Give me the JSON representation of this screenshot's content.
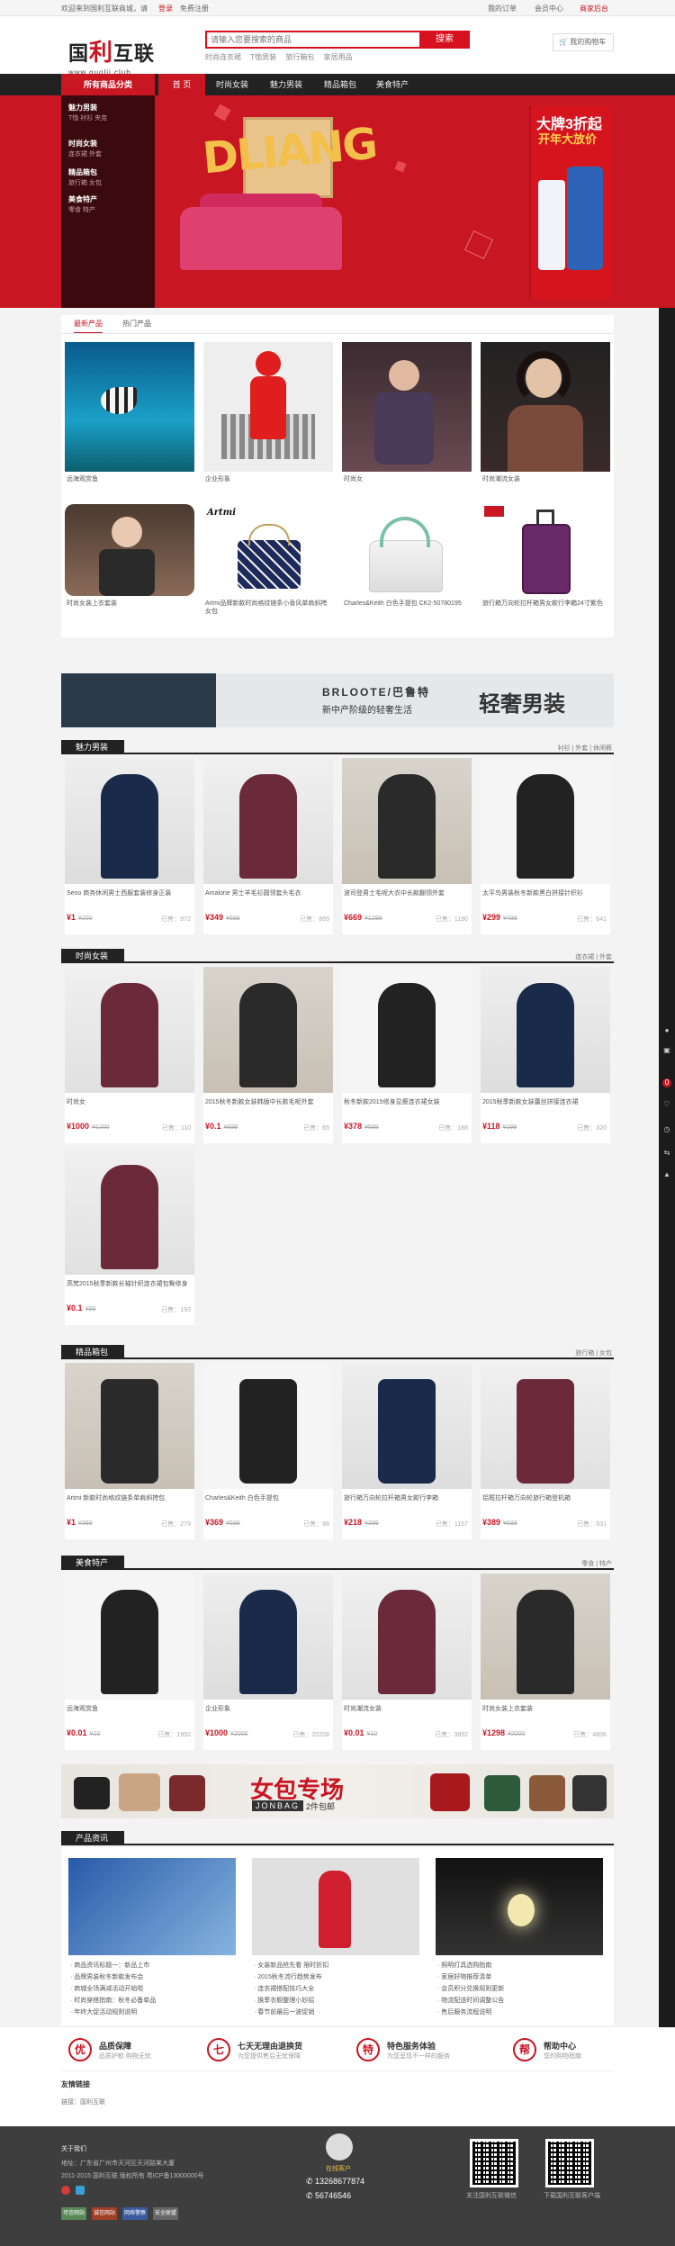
{
  "topbar": {
    "welcome": "欢迎来到国利互联商城，请",
    "login": "登录",
    "register": "免费注册",
    "my_orders": "我的订单",
    "user_center": "会员中心",
    "seller": "商家后台"
  },
  "header": {
    "logo_cn_a": "国",
    "logo_cn_b": "利",
    "logo_cn_c": "互联",
    "logo_url": "www.guolii.club",
    "search_placeholder": "请输入您要搜索的商品",
    "search_button": "搜索",
    "hot_words": [
      "时尚连衣裙",
      "T恤男装",
      "旅行箱包",
      "家居用品"
    ],
    "cart_label": "我的购物车"
  },
  "nav": {
    "category_label": "所有商品分类",
    "items": [
      "首 页",
      "时尚女装",
      "魅力男装",
      "精品箱包",
      "美食特产"
    ],
    "active_index": 0
  },
  "categories": [
    {
      "name": "魅力男装",
      "subs": "T恤 衬衫 夹克"
    },
    {
      "name": "时尚女装",
      "subs": "连衣裙 外套"
    },
    {
      "name": "精品箱包",
      "subs": "旅行箱 女包"
    },
    {
      "name": "美食特产",
      "subs": "零食 特产"
    }
  ],
  "banner": {
    "headline": "DLIANG",
    "promo_line1": "大牌3折起",
    "promo_line2": "开年大放价",
    "accent": "#c81623"
  },
  "tabs": [
    "最新产品",
    "热门产品"
  ],
  "tab_products": [
    {
      "name": "远海观赏鱼"
    },
    {
      "name": "企业形象"
    },
    {
      "name": "时尚女"
    },
    {
      "name": "时尚潮流女装"
    },
    {
      "name": "时尚女装上衣套装"
    },
    {
      "name": "Artmi品牌新款时尚格纹链条小香风单肩斜挎女包"
    },
    {
      "name": "Charles&Keith 白色手提包 CK2-50780195"
    },
    {
      "name": "旅行箱万向轮拉杆箱男女款行李箱24寸紫色"
    }
  ],
  "ad1": {
    "brand": "BRLOOTE/巴鲁特",
    "slogan": "新中产阶级的轻奢生活",
    "title": "轻奢男装"
  },
  "sections": [
    {
      "title": "魅力男装",
      "more": "衬衫 | 外套 | 休闲裤",
      "products": [
        {
          "name": "Seno 商务休闲男士西服套装修身正装",
          "price": "¥1",
          "old": "¥200",
          "sold": "已售：972"
        },
        {
          "name": "Amalone 男士羊毛衫圆领套头毛衣",
          "price": "¥349",
          "old": "¥599",
          "sold": "已售：889"
        },
        {
          "name": "波司登男士毛呢大衣中长款翻领外套",
          "price": "¥669",
          "old": "¥1299",
          "sold": "已售：1190"
        },
        {
          "name": "太平鸟男装秋冬新款黑白拼接针织衫",
          "price": "¥299",
          "old": "¥499",
          "sold": "已售：641"
        }
      ]
    },
    {
      "title": "时尚女装",
      "more": "连衣裙 | 外套",
      "products": [
        {
          "name": "时尚女",
          "price": "¥1000",
          "old": "¥1200",
          "sold": "已售：110"
        },
        {
          "name": "2015秋冬新款女装韩版中长款毛呢外套",
          "price": "¥0.1",
          "old": "¥899",
          "sold": "已售：65"
        },
        {
          "name": "秋冬新款2015修身显瘦连衣裙女装",
          "price": "¥378",
          "old": "¥599",
          "sold": "已售：188"
        },
        {
          "name": "2015秋季新款女装蕾丝拼接连衣裙",
          "price": "¥118",
          "old": "¥299",
          "sold": "已售：320"
        },
        {
          "name": "高梵2015秋季新款长袖针织连衣裙包臀修身",
          "price": "¥0.1",
          "old": "¥99",
          "sold": "已售：193"
        }
      ]
    },
    {
      "title": "精品箱包",
      "more": "旅行箱 | 女包",
      "products": [
        {
          "name": "Artmi 新款时尚格纹链条单肩斜挎包",
          "price": "¥1",
          "old": "¥369",
          "sold": "已售：279"
        },
        {
          "name": "Charles&Keith 白色手提包",
          "price": "¥369",
          "old": "¥599",
          "sold": "已售：88"
        },
        {
          "name": "旅行箱万向轮拉杆箱男女款行李箱",
          "price": "¥218",
          "old": "¥399",
          "sold": "已售：1157"
        },
        {
          "name": "铝框拉杆箱万向轮旅行箱登机箱",
          "price": "¥389",
          "old": "¥699",
          "sold": "已售：531"
        }
      ]
    },
    {
      "title": "美食特产",
      "more": "零食 | 特产",
      "products": [
        {
          "name": "远海观赏鱼",
          "price": "¥0.01",
          "old": "¥10",
          "sold": "已售：1992"
        },
        {
          "name": "企业形象",
          "price": "¥1000",
          "old": "¥2000",
          "sold": "已售：20208"
        },
        {
          "name": "时尚潮流女装",
          "price": "¥0.01",
          "old": "¥10",
          "sold": "已售：3892"
        },
        {
          "name": "时尚女装上衣套装",
          "price": "¥1298",
          "old": "¥2000",
          "sold": "已售：4806"
        }
      ]
    }
  ],
  "ad2": {
    "title": "女包专场",
    "brand": "JONBAG",
    "promo": "2件包邮"
  },
  "news": {
    "title": "产品资讯",
    "columns": [
      [
        "商品资讯标题一：新品上市",
        "品牌男装秋冬新款发布会",
        "商城全场满减活动开始啦",
        "时尚穿搭指南：秋冬必备单品",
        "年终大促活动规则说明"
      ],
      [
        "女装新品抢先看 限时折扣",
        "2015秋冬流行趋势发布",
        "连衣裙搭配技巧大全",
        "换季衣橱整理小妙招",
        "春节前最后一波促销"
      ],
      [
        "照明灯具选购指南",
        "家居好物推荐清单",
        "会员积分兑换规则更新",
        "物流配送时间调整公告",
        "售后服务流程说明"
      ]
    ]
  },
  "services": [
    {
      "icon": "优",
      "title": "品质保障",
      "desc": "品质护航 购物无忧"
    },
    {
      "icon": "七",
      "title": "七天无理由退换货",
      "desc": "为您提供售后无忧保障"
    },
    {
      "icon": "特",
      "title": "特色服务体验",
      "desc": "为您呈现不一样的服务"
    },
    {
      "icon": "帮",
      "title": "帮助中心",
      "desc": "您的购物指南"
    }
  ],
  "friend_links": {
    "title": "友情链接",
    "items": [
      "国利互联"
    ]
  },
  "footer": {
    "about": "关于我们",
    "address": "地址：广东省广州市天河区天河路某大厦",
    "copyright": "2011-2015 国利互联 版权所有 粤ICP备13000000号",
    "phone1": "13268677874",
    "phone2": "56746546",
    "qr1_label": "关注国利互联微信",
    "qr2_label": "下载国利互联客户端",
    "badges": [
      "可信网站",
      "诚信网站",
      "网络警察",
      "安全联盟"
    ]
  }
}
